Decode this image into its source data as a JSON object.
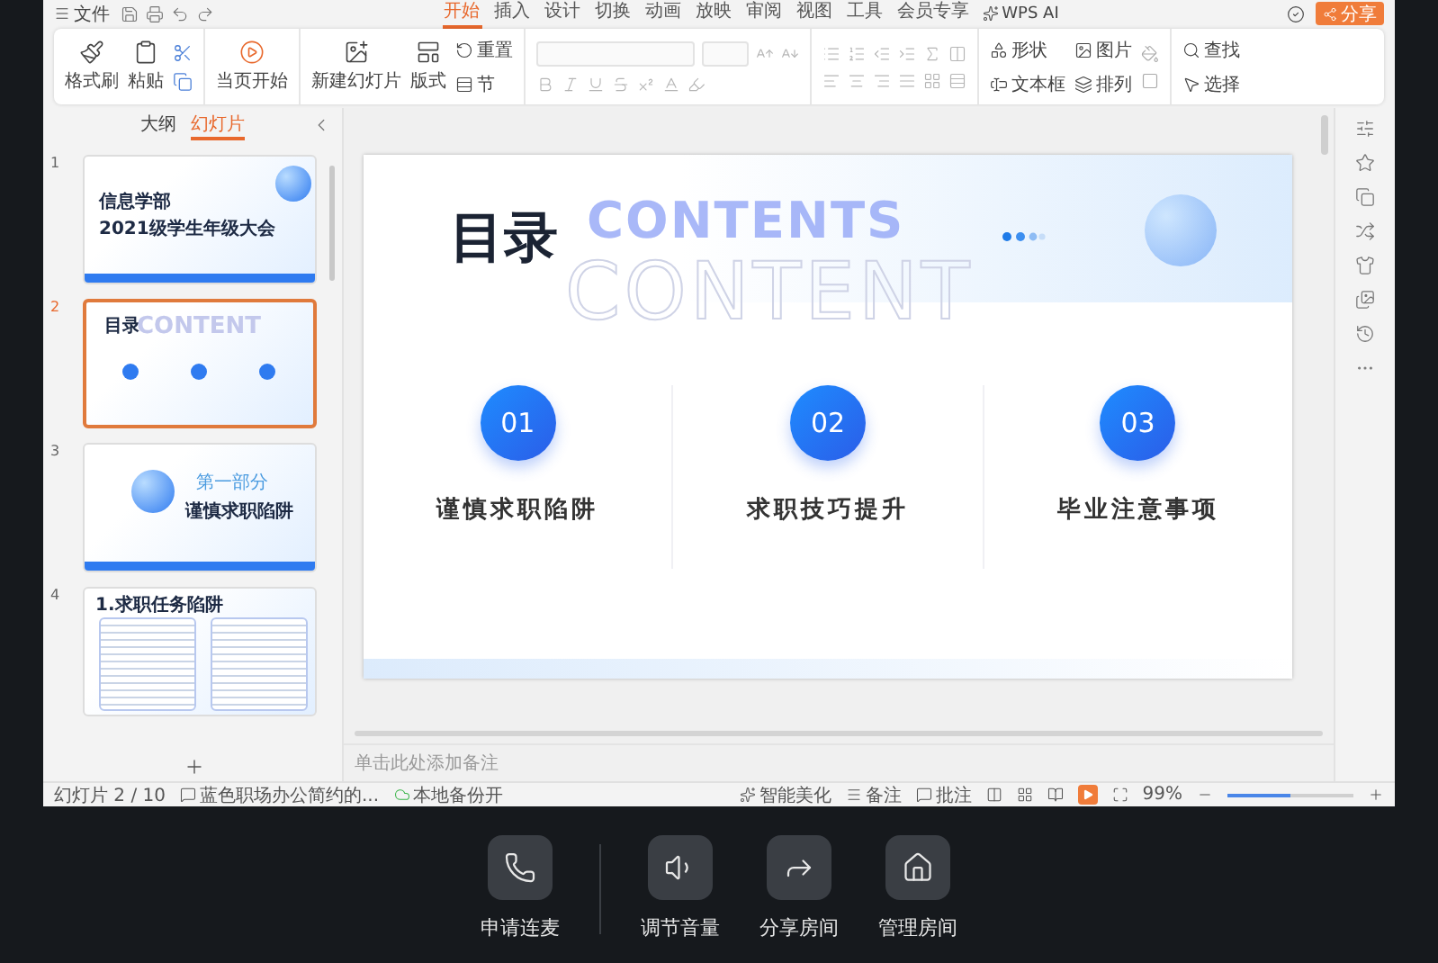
{
  "title_bar": {
    "file_menu": "文件",
    "tabs": [
      {
        "label": "开始",
        "selected": true
      },
      {
        "label": "插入",
        "selected": false
      },
      {
        "label": "设计",
        "selected": false
      },
      {
        "label": "切换",
        "selected": false
      },
      {
        "label": "动画",
        "selected": false
      },
      {
        "label": "放映",
        "selected": false
      },
      {
        "label": "审阅",
        "selected": false
      },
      {
        "label": "视图",
        "selected": false
      },
      {
        "label": "工具",
        "selected": false
      },
      {
        "label": "会员专享",
        "selected": false
      }
    ],
    "ai_label": "WPS AI",
    "share_button": "分享"
  },
  "ribbon": {
    "format_painter": "格式刷",
    "paste": "粘贴",
    "start_from_current": "当页开始",
    "new_slide": "新建幻灯片",
    "layout": "版式",
    "reset": "重置",
    "section": "节",
    "shape": "形状",
    "picture": "图片",
    "text_box": "文本框",
    "arrange": "排列",
    "find": "查找",
    "select": "选择"
  },
  "left_panel": {
    "tabs": [
      {
        "label": "大纲",
        "selected": false
      },
      {
        "label": "幻灯片",
        "selected": true
      }
    ],
    "slides": [
      {
        "number": "1",
        "selected": false,
        "kind": "cover",
        "title": "信息学部",
        "subtitle": "2021级学生年级大会"
      },
      {
        "number": "2",
        "selected": true,
        "kind": "contents",
        "title": "目录",
        "watermark": "CONTENT"
      },
      {
        "number": "3",
        "selected": false,
        "kind": "section",
        "title": "第一部分",
        "subtitle": "谨慎求职陷阱"
      },
      {
        "number": "4",
        "selected": false,
        "kind": "text",
        "title": "1.求职任务陷阱"
      }
    ]
  },
  "slide": {
    "title": "目录",
    "heading": "CONTENTS",
    "watermark": "CONTENT",
    "items": [
      {
        "number": "01",
        "label": "谨慎求职陷阱"
      },
      {
        "number": "02",
        "label": "求职技巧提升"
      },
      {
        "number": "03",
        "label": "毕业注意事项"
      }
    ]
  },
  "notes_placeholder": "单击此处添加备注",
  "status_bar": {
    "slide_count": "幻灯片 2 / 10",
    "theme": "蓝色职场办公简约的...",
    "backup": "本地备份开",
    "beautify": "智能美化",
    "notes": "备注",
    "comments": "批注",
    "zoom": "99%",
    "zoom_slider": {
      "level": 0.5
    }
  },
  "bottom_bar": {
    "actions": [
      {
        "label": "申请连麦"
      },
      {
        "label": "调节音量"
      },
      {
        "label": "分享房间"
      },
      {
        "label": "管理房间"
      }
    ]
  }
}
